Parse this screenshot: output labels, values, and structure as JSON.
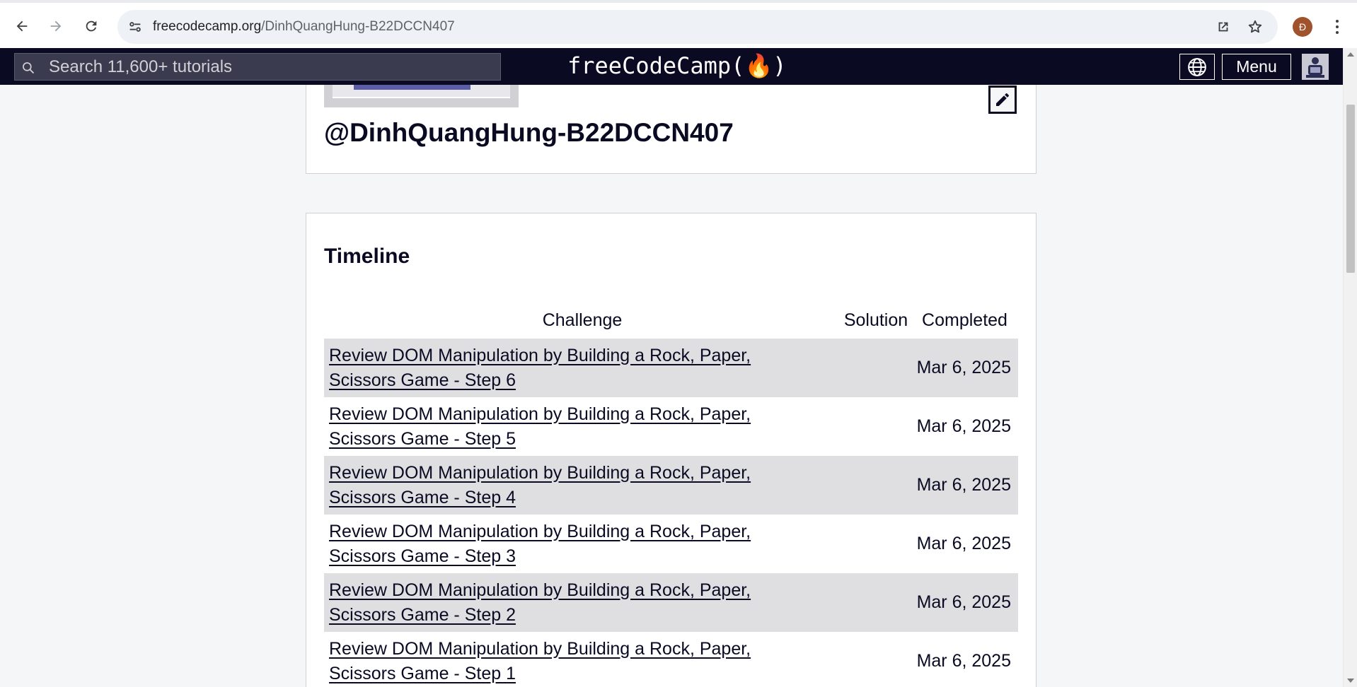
{
  "browser": {
    "url_domain": "freecodecamp.org",
    "url_path": "/DinhQuangHung-B22DCCN407",
    "profile_initial": "Đ"
  },
  "nav": {
    "search_placeholder": "Search 11,600+ tutorials",
    "logo_text": "freeCodeCamp(🔥)",
    "menu_label": "Menu"
  },
  "profile": {
    "username": "@DinhQuangHung-B22DCCN407"
  },
  "timeline": {
    "title": "Timeline",
    "headers": {
      "challenge": "Challenge",
      "solution": "Solution",
      "completed": "Completed"
    },
    "rows": [
      {
        "challenge": "Review DOM Manipulation by Building a Rock, Paper, Scissors Game - Step 6",
        "solution": "",
        "completed": "Mar 6, 2025"
      },
      {
        "challenge": "Review DOM Manipulation by Building a Rock, Paper, Scissors Game - Step 5",
        "solution": "",
        "completed": "Mar 6, 2025"
      },
      {
        "challenge": "Review DOM Manipulation by Building a Rock, Paper, Scissors Game - Step 4",
        "solution": "",
        "completed": "Mar 6, 2025"
      },
      {
        "challenge": "Review DOM Manipulation by Building a Rock, Paper, Scissors Game - Step 3",
        "solution": "",
        "completed": "Mar 6, 2025"
      },
      {
        "challenge": "Review DOM Manipulation by Building a Rock, Paper, Scissors Game - Step 2",
        "solution": "",
        "completed": "Mar 6, 2025"
      },
      {
        "challenge": "Review DOM Manipulation by Building a Rock, Paper, Scissors Game - Step 1",
        "solution": "",
        "completed": "Mar 6, 2025"
      }
    ]
  },
  "colors": {
    "nav_bg": "#0a0a23",
    "page_bg": "#f5f6f7",
    "row_shade": "#dfdfe2",
    "text": "#0a0a23"
  },
  "icons": [
    "back-icon",
    "forward-icon",
    "reload-icon",
    "site-info-icon",
    "open-in-app-icon",
    "bookmark-star-icon",
    "search-icon",
    "globe-icon",
    "pencil-icon"
  ]
}
